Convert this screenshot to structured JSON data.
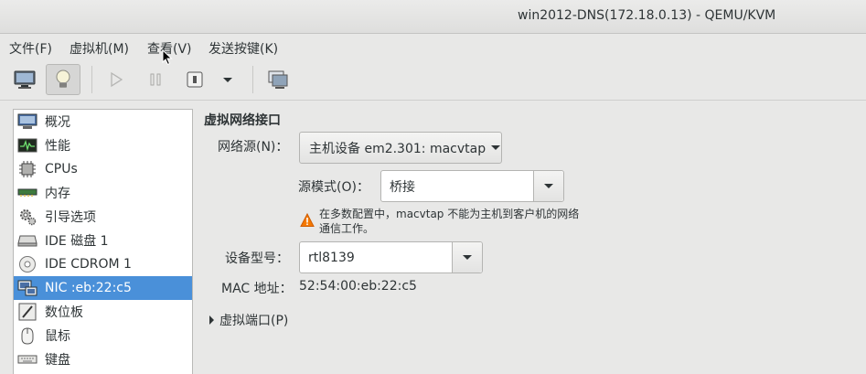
{
  "window": {
    "title": "win2012-DNS(172.18.0.13) - QEMU/KVM"
  },
  "menu": {
    "items": [
      "文件(F)",
      "虚拟机(M)",
      "查看(V)",
      "发送按键(K)"
    ]
  },
  "toolbar": {
    "buttons": [
      "monitor-icon",
      "lightbulb-icon",
      "play-icon",
      "pause-icon",
      "power-icon",
      "dropdown-arrow-icon",
      "screenshot-icon"
    ]
  },
  "sidebar": {
    "items": [
      {
        "label": "概况",
        "icon": "overview-icon"
      },
      {
        "label": "性能",
        "icon": "performance-icon"
      },
      {
        "label": "CPUs",
        "icon": "cpu-icon"
      },
      {
        "label": "内存",
        "icon": "memory-icon"
      },
      {
        "label": "引导选项",
        "icon": "boot-options-icon"
      },
      {
        "label": "IDE 磁盘 1",
        "icon": "disk-icon"
      },
      {
        "label": "IDE CDROM 1",
        "icon": "cdrom-icon"
      },
      {
        "label": "NIC :eb:22:c5",
        "icon": "network-icon"
      },
      {
        "label": "数位板",
        "icon": "tablet-icon"
      },
      {
        "label": "鼠标",
        "icon": "mouse-icon"
      },
      {
        "label": "键盘",
        "icon": "keyboard-icon"
      }
    ],
    "selected_index": 7
  },
  "detail": {
    "heading": "虚拟网络接口",
    "network_source_label": "网络源(N)：",
    "network_source_value": "主机设备  em2.301: macvtap",
    "source_mode_label": "源模式(O)：",
    "source_mode_value": "桥接",
    "warning_line1": "在多数配置中，macvtap 不能为主机到客户机的网络",
    "warning_line2": "通信工作。",
    "device_model_label": "设备型号：",
    "device_model_value": "rtl8139",
    "mac_label": "MAC 地址：",
    "mac_value": "52:54:00:eb:22:c5",
    "virtual_port_label": "虚拟端口(P)"
  },
  "colors": {
    "selection": "#4a90d9",
    "warning": "#f57900"
  }
}
